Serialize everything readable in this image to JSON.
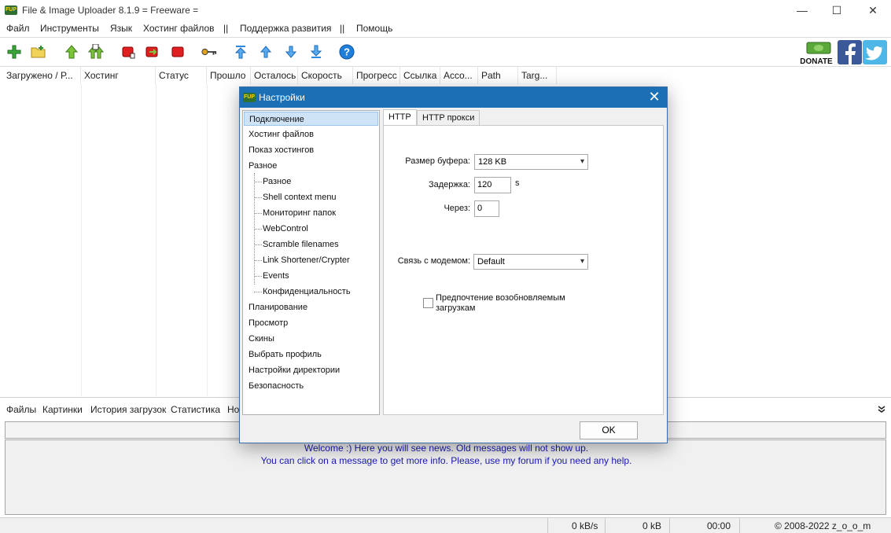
{
  "window": {
    "title": "File & Image Uploader 8.1.9  = Freeware =",
    "logo_text": "FUP",
    "minimize": "—",
    "maximize": "☐",
    "close": "✕"
  },
  "menu": [
    "Файл",
    "Инструменты",
    "Язык",
    "Хостинг файлов",
    "||",
    "Поддержка развития",
    "||",
    "Помощь"
  ],
  "toolbar": {
    "icons": [
      "add-icon",
      "folder-add-icon",
      "upload-up-icon",
      "upload-all-icon",
      "stop-icon",
      "stop-next-icon",
      "stop-all-icon",
      "key-icon",
      "move-top-icon",
      "move-up-icon",
      "move-down-icon",
      "move-bottom-icon",
      "help-icon"
    ],
    "donate_label": "DONATE"
  },
  "columns": [
    "Загружено / Р...",
    "Хостинг",
    "Статус",
    "Прошло",
    "Осталось",
    "Скорость",
    "Прогресс",
    "Ссылка",
    "Acco...",
    "Path",
    "Targ..."
  ],
  "bottom_tabs": [
    "Файлы",
    "Картинки",
    "История загрузок",
    "Статистика",
    "Но"
  ],
  "news": {
    "line1": "Welcome :) Here you will see news. Old messages will not show up.",
    "line2": "You can click on a message to get more info. Please, use my forum if you need any help."
  },
  "status": {
    "speed": "0 kB/s",
    "size": "0 kB",
    "time": "00:00",
    "copyright": "© 2008-2022 z_o_o_m"
  },
  "dialog": {
    "title": "Настройки",
    "logo_text": "FUP",
    "close": "✕",
    "tree": {
      "top_items": [
        "Подключение",
        "Хостинг файлов",
        "Показ хостингов",
        "Разное"
      ],
      "sub_items": [
        "Разное",
        "Shell context menu",
        "Мониторинг папок",
        "WebControl",
        "Scramble filenames",
        "Link Shortener/Crypter",
        "Events",
        "Конфиденциальность"
      ],
      "bottom_items": [
        "Планирование",
        "Просмотр",
        "Скины",
        "Выбрать профиль",
        "Настройки директории",
        "Безопасность"
      ]
    },
    "tabs": [
      "HTTP",
      "HTTP прокси"
    ],
    "fields": {
      "buffer_label": "Размер буфера:",
      "buffer_value": "128 KB",
      "delay_label": "Задержка:",
      "delay_value": "120",
      "delay_unit": "s",
      "after_label": "Через:",
      "after_value": "0",
      "modem_label": "Связь с модемом:",
      "modem_value": "Default",
      "resume_label_1": "Предпочтение возобновляемым",
      "resume_label_2": "загрузкам",
      "resume_checked": false
    },
    "ok_label": "OK"
  },
  "colors": {
    "dialog_title_bg": "#1a6fb5",
    "selection_bg": "#cfe3f7",
    "news_text": "#1a1ab0"
  }
}
